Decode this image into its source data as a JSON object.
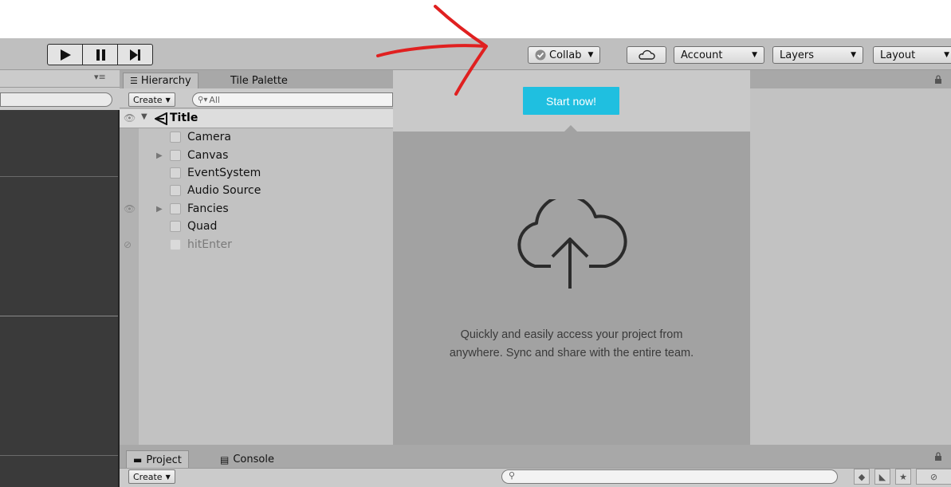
{
  "toolbar": {
    "collab_label": "Collab",
    "account_label": "Account",
    "layers_label": "Layers",
    "layout_label": "Layout"
  },
  "hierarchy": {
    "tab_hierarchy": "Hierarchy",
    "tab_tile_palette": "Tile Palette",
    "create_label": "Create",
    "search_placeholder": "All",
    "scene_name": "Title",
    "items": [
      {
        "label": "Camera"
      },
      {
        "label": "Canvas"
      },
      {
        "label": "EventSystem"
      },
      {
        "label": "Audio Source"
      },
      {
        "label": "Fancies"
      },
      {
        "label": "Quad"
      },
      {
        "label": "hitEnter"
      }
    ]
  },
  "collab_popup": {
    "start_button": "Start now!",
    "description_line1": "Quickly and easily access your project from",
    "description_line2": "anywhere. Sync and share with the entire team."
  },
  "project": {
    "tab_project": "Project",
    "tab_console": "Console",
    "create_label": "Create"
  },
  "colors": {
    "start_button": "#1fbfe0",
    "annotation_arrow": "#e02020"
  }
}
